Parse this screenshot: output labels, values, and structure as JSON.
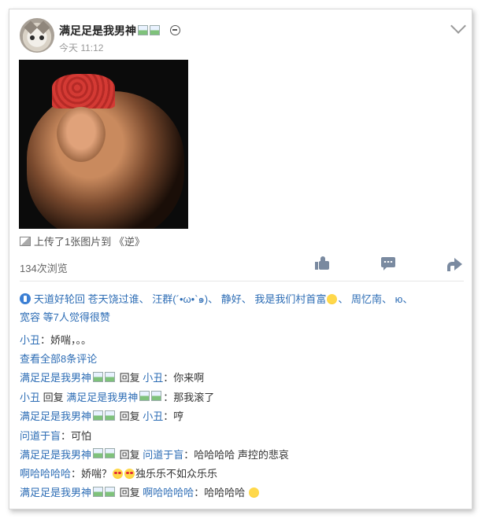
{
  "post": {
    "username": "满足足是我男神",
    "time": "今天 11:12",
    "upload_text": "上传了1张图片到 《逆》",
    "views": "134次浏览"
  },
  "likes": {
    "names": [
      "天道好轮回",
      "苍天饶过谁",
      "汪群(´•ω•`๑)",
      "静好",
      "我是我们村首富",
      "周忆南",
      "ю",
      "宽容"
    ],
    "suffix": "等7人觉得很赞"
  },
  "comments": {
    "c1": {
      "name": "小丑",
      "text": "：娇喘，。。"
    },
    "view_all": "查看全部8条评论",
    "c2": {
      "name": "满足足是我男神",
      "reply": "回复",
      "target": "小丑",
      "text": "：你来啊"
    },
    "c3": {
      "name": "小丑",
      "reply": "回复",
      "target": "满足足是我男神",
      "text": "：那我滚了"
    },
    "c4": {
      "name": "满足足是我男神",
      "reply": "回复",
      "target": "小丑",
      "text": "：哼"
    },
    "c5": {
      "name": "问道于盲",
      "text": "：可怕"
    },
    "c6": {
      "name": "满足足是我男神",
      "reply": "回复",
      "target": "问道于盲",
      "text": "：哈哈哈哈 声控的悲哀"
    },
    "c7": {
      "name": "啊哈哈哈哈",
      "text": "：娇喘？",
      "text2": "独乐乐不如众乐乐"
    },
    "c8": {
      "name": "满足足是我男神",
      "reply": "回复",
      "target": "啊哈哈哈哈",
      "text": "：哈哈哈哈"
    }
  },
  "icons": [
    "cat-avatar",
    "message-icon",
    "chevron-down-icon",
    "image-icon",
    "like-icon",
    "comment-icon",
    "share-icon",
    "thumbs-up-icon",
    "emoji-icon"
  ],
  "colors": {
    "link": "#2d6db5",
    "icon": "#7a8aa0"
  }
}
